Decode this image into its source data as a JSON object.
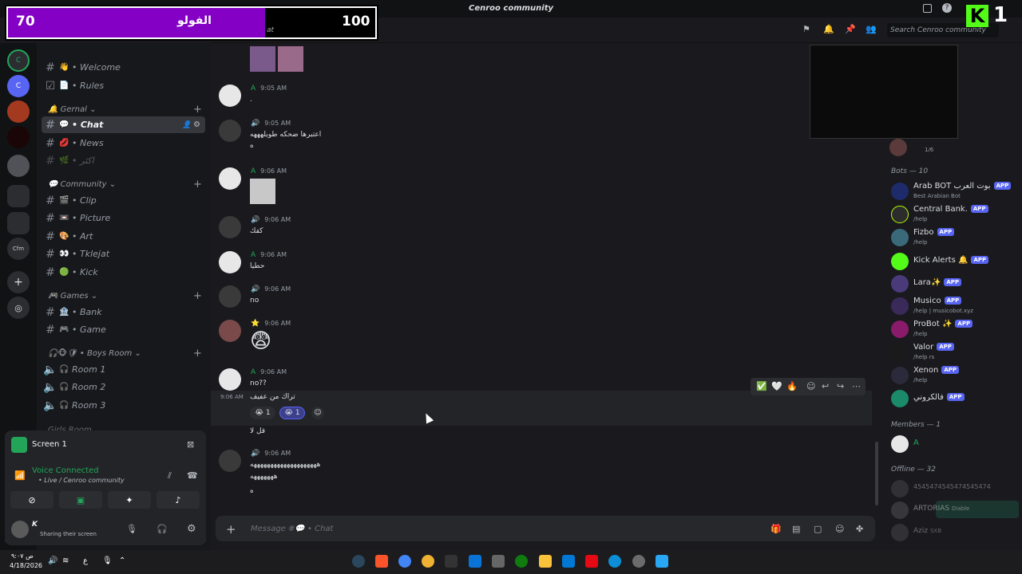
{
  "window": {
    "title": "Cenroo community"
  },
  "overlay": {
    "left_score": "70",
    "label": "الفولو",
    "right_score": "100",
    "partial_text": "at"
  },
  "header": {
    "search_placeholder": "Search Cenroo community"
  },
  "streamer_badge": {
    "letter": "K",
    "number": "1"
  },
  "sidebar": {
    "top_channels": [
      {
        "emoji": "👋",
        "label": "• Welcome"
      },
      {
        "emoji": "📄",
        "label": "• Rules"
      }
    ],
    "categories": {
      "gernal": "Gernal",
      "community": "Community",
      "games": "Games",
      "boys_room": "Boys Room",
      "girls_room": "Girls Room"
    },
    "gernal_channels": [
      {
        "emoji": "💬",
        "label": "• Chat"
      },
      {
        "emoji": "💋",
        "label": "• News"
      },
      {
        "emoji": "🌿",
        "label": "• اكثر"
      }
    ],
    "community_channels": [
      {
        "emoji": "🎬",
        "label": "• Clip"
      },
      {
        "emoji": "📼",
        "label": "• Picture"
      },
      {
        "emoji": "🎨",
        "label": "• Art"
      },
      {
        "emoji": "👀",
        "label": "• Tklejat"
      },
      {
        "emoji": "🟢",
        "label": "• Kick"
      }
    ],
    "games_channels": [
      {
        "emoji": "🏦",
        "label": "• Bank"
      },
      {
        "emoji": "🎮",
        "label": "• Game"
      }
    ],
    "voice_channels": [
      {
        "label": "Room 1"
      },
      {
        "label": "Room 2"
      },
      {
        "label": "Room 3"
      }
    ]
  },
  "voice_panel": {
    "screen_label": "Screen 1",
    "status": "Voice Connected",
    "channel": "• Live / Cenroo community",
    "user_name": "K",
    "user_status": "Sharing their screen"
  },
  "messages": [
    {
      "name": "A",
      "time": "9:05 AM",
      "text": "."
    },
    {
      "name": "",
      "time": "9:05 AM",
      "text": "اعتبرها ضحكه طويلهههه",
      "text2": "ه"
    },
    {
      "name": "A",
      "time": "9:06 AM",
      "text": ""
    },
    {
      "name": "",
      "time": "9:06 AM",
      "text": "كفك"
    },
    {
      "name": "A",
      "time": "9:06 AM",
      "text": "حطيا"
    },
    {
      "name": "",
      "time": "9:06 AM",
      "text": "no"
    },
    {
      "name": "",
      "time": "9:06 AM",
      "text": "😨"
    },
    {
      "name": "A",
      "time": "9:06 AM",
      "text": "no??"
    },
    {
      "name": "",
      "time": "9:06 AM",
      "text": "تراك من عفيف"
    },
    {
      "name": "",
      "time": "",
      "text": "قل لا"
    },
    {
      "name": "",
      "time": "9:06 AM",
      "text": "ههههههههههههههههههههه",
      "text2": "هههههههه",
      "text3": "ه"
    }
  ],
  "reactions": [
    {
      "emoji": "😭",
      "count": "1"
    },
    {
      "emoji": "😭",
      "count": "1"
    }
  ],
  "composer": {
    "placeholder": "Message #💬 • Chat"
  },
  "members": {
    "bots_header": "Bots — 10",
    "bots": [
      {
        "name": "Arab BOT بوت العرب",
        "sub": "Best Arabian Bot"
      },
      {
        "name": "Central Bank.",
        "sub": "/help"
      },
      {
        "name": "Fizbo",
        "sub": "/help"
      },
      {
        "name": "Kick Alerts 🔔",
        "sub": ""
      },
      {
        "name": "Lara✨",
        "sub": ""
      },
      {
        "name": "Musico",
        "sub": "/help | musicobot.xyz"
      },
      {
        "name": "ProBot ✨",
        "sub": "/help"
      },
      {
        "name": "Valor",
        "sub": "/help rs"
      },
      {
        "name": "Xenon",
        "sub": "/help"
      },
      {
        "name": "فالكروني",
        "sub": ""
      }
    ],
    "app_label": "APP",
    "members_header": "Members — 1",
    "member_a": "A",
    "offline_header": "Offline — 32",
    "offline": [
      {
        "name": "4545474545474545474"
      },
      {
        "name": "ARTORIAS",
        "tag": "Diable"
      },
      {
        "name": "Aziz",
        "tag": "SXB"
      }
    ],
    "top_member_sub": "1/6"
  },
  "taskbar": {
    "time": "ص ٩:٠٧",
    "date": "4/18/2026",
    "lang": "ع"
  }
}
